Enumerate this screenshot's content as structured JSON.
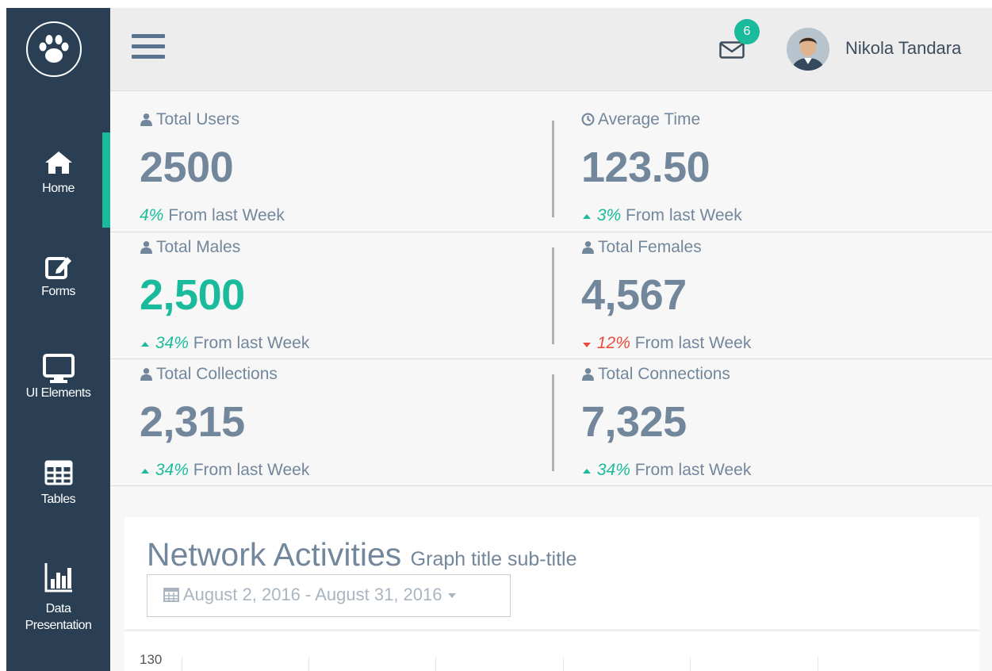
{
  "sidebar": {
    "items": [
      {
        "label": "Home",
        "icon": "home-icon",
        "active": true
      },
      {
        "label": "Forms",
        "icon": "edit-icon"
      },
      {
        "label": "UI Elements",
        "icon": "desktop-icon"
      },
      {
        "label": "Tables",
        "icon": "table-icon"
      },
      {
        "label": "Data",
        "label2": "Presentation",
        "icon": "bar-chart-icon"
      }
    ]
  },
  "header": {
    "mail_count": "6",
    "user_name": "Nikola Tandara"
  },
  "stats": [
    {
      "title": "Total Users",
      "value": "2500",
      "pct": "4%",
      "suffix": "From last Week"
    },
    {
      "title": "Average Time",
      "value": "123.50",
      "pct": "3%",
      "suffix": "From last Week"
    },
    {
      "title": "Total Males",
      "value": "2,500",
      "pct": "34%",
      "suffix": "From last Week"
    },
    {
      "title": "Total Females",
      "value": "4,567",
      "pct": "12%",
      "suffix": "From last Week"
    },
    {
      "title": "Total Collections",
      "value": "2,315",
      "pct": "34%",
      "suffix": "From last Week"
    },
    {
      "title": "Total Connections",
      "value": "7,325",
      "pct": "34%",
      "suffix": "From last Week"
    }
  ],
  "panel": {
    "title": "Network Activities",
    "subtitle": "Graph title sub-title",
    "date_range": "August 2, 2016 - August 31, 2016",
    "y_tick": "130"
  },
  "colors": {
    "sidebar_bg": "#2a3f54",
    "accent_green": "#1abb9c",
    "down_red": "#e74c3c",
    "stat_text": "#73879c"
  }
}
